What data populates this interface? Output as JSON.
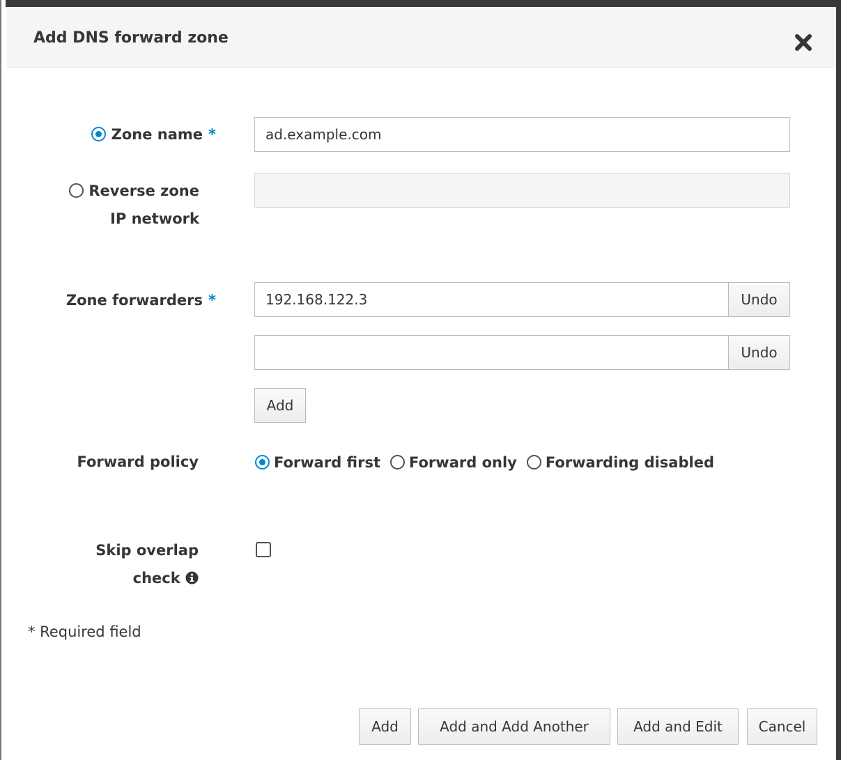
{
  "dialog": {
    "title": "Add DNS forward zone",
    "close_icon": "close-icon"
  },
  "zone_name": {
    "label": "Zone name",
    "required_mark": "*",
    "value": "ad.example.com",
    "selected": true
  },
  "reverse_zone": {
    "label_line1": "Reverse zone",
    "label_line2": "IP network",
    "value": "",
    "selected": false
  },
  "zone_forwarders": {
    "label": "Zone forwarders",
    "required_mark": "*",
    "entries": [
      {
        "value": "192.168.122.3",
        "undo_label": "Undo"
      },
      {
        "value": "",
        "undo_label": "Undo"
      }
    ],
    "add_label": "Add"
  },
  "forward_policy": {
    "label": "Forward policy",
    "options": [
      {
        "label": "Forward first",
        "selected": true
      },
      {
        "label": "Forward only",
        "selected": false
      },
      {
        "label": "Forwarding disabled",
        "selected": false
      }
    ]
  },
  "skip_overlap": {
    "label_line1": "Skip overlap",
    "label_line2": "check",
    "checked": false,
    "info_icon": "info-icon"
  },
  "required_note": "* Required field",
  "footer": {
    "add": "Add",
    "add_another": "Add and Add Another",
    "add_edit": "Add and Edit",
    "cancel": "Cancel"
  },
  "colors": {
    "accent": "#0088ce",
    "header_bg": "#f5f5f5"
  }
}
